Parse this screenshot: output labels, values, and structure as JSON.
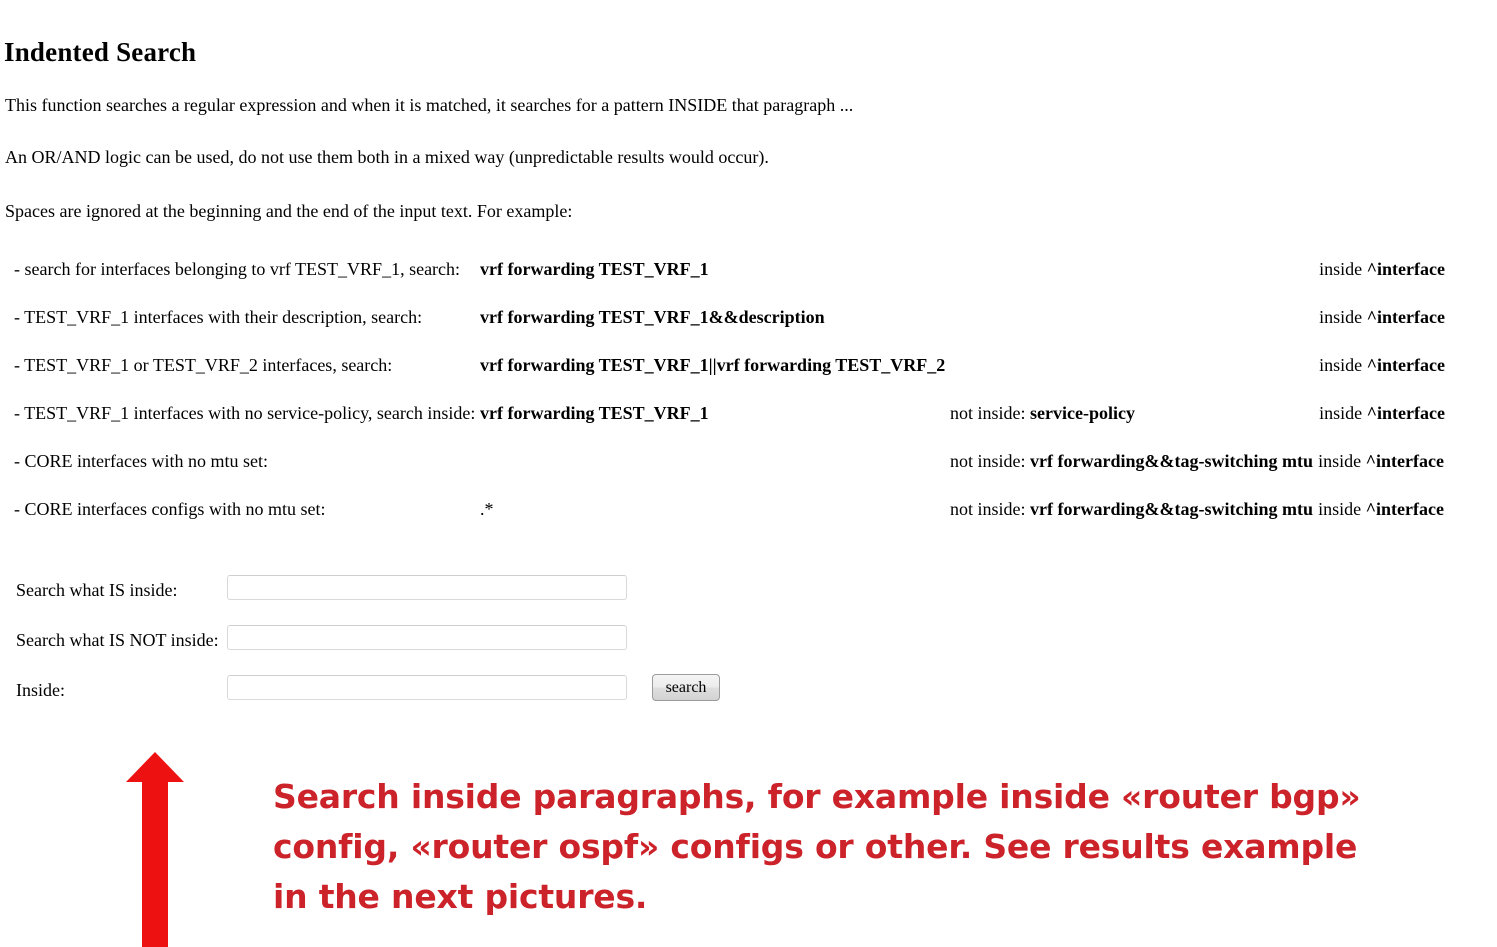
{
  "page": {
    "title": "Indented Search",
    "intro": [
      "This function searches a regular expression and when it is matched, it searches for a pattern INSIDE that paragraph ...",
      "An OR/AND logic can be used, do not use them both in a mixed way (unpredictable results would occur).",
      "Spaces are ignored at the beginning and the end of the input text. For example:"
    ]
  },
  "examples": {
    "rows": [
      {
        "description": "- search for interfaces belonging to vrf TEST_VRF_1, search:",
        "pattern": "vrf forwarding TEST_VRF_1",
        "pattern_bold": true,
        "not_inside_label": "",
        "not_inside_value": "",
        "inside_label": "inside ",
        "inside_value": "^interface"
      },
      {
        "description": "- TEST_VRF_1 interfaces with their description, search:",
        "pattern": "vrf forwarding TEST_VRF_1&&description",
        "pattern_bold": true,
        "not_inside_label": "",
        "not_inside_value": "",
        "inside_label": "inside ",
        "inside_value": "^interface"
      },
      {
        "description": "- TEST_VRF_1 or TEST_VRF_2 interfaces, search:",
        "pattern": "vrf forwarding TEST_VRF_1||vrf forwarding TEST_VRF_2",
        "pattern_bold": true,
        "not_inside_label": "",
        "not_inside_value": "",
        "inside_label": "inside ",
        "inside_value": "^interface"
      },
      {
        "description": "- TEST_VRF_1 interfaces with no service-policy, search inside:",
        "pattern": "vrf forwarding TEST_VRF_1",
        "pattern_bold": true,
        "not_inside_label": "not inside: ",
        "not_inside_value": "service-policy",
        "inside_label": "inside ",
        "inside_value": "^interface"
      },
      {
        "description": "- CORE interfaces with no mtu set:",
        "pattern": "",
        "pattern_bold": true,
        "not_inside_label": "not inside: ",
        "not_inside_value": "vrf forwarding&&tag-switching mtu",
        "inside_label": "inside ",
        "inside_value": "^interface"
      },
      {
        "description": "- CORE interfaces configs with no mtu set:",
        "pattern": ".*",
        "pattern_bold": false,
        "not_inside_label": "not inside: ",
        "not_inside_value": "vrf forwarding&&tag-switching mtu",
        "inside_label": "inside ",
        "inside_value": "^interface"
      }
    ]
  },
  "form": {
    "fields": [
      {
        "label": "Search what IS inside:",
        "value": "",
        "placeholder": ""
      },
      {
        "label": "Search what IS NOT inside:",
        "value": "",
        "placeholder": ""
      },
      {
        "label": "Inside:",
        "value": "",
        "placeholder": ""
      }
    ],
    "search_button": "search"
  },
  "annotation": {
    "color": "#CC2229",
    "lines": [
      "Search inside paragraphs, for example inside «router bgp»",
      "config, «router ospf» configs or other. See results example",
      "in the next pictures."
    ],
    "arrow_icon": "up-arrow-icon"
  }
}
